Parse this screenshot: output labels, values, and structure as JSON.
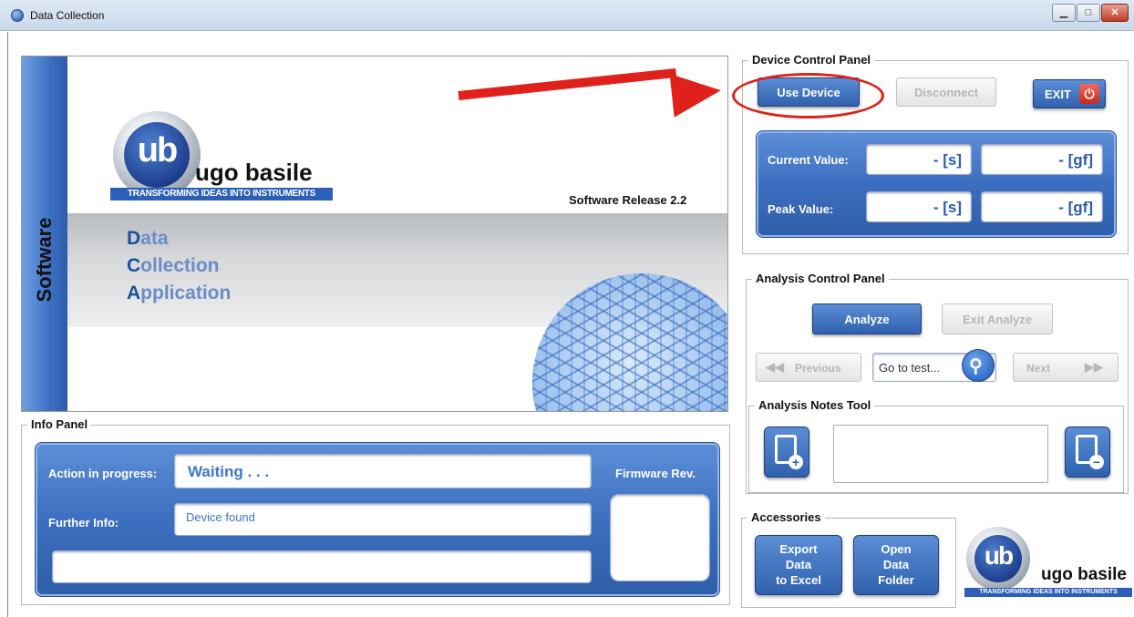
{
  "window": {
    "title": "Data Collection",
    "controls": {
      "minimize": "▁",
      "maximize": "□",
      "close": "✕"
    }
  },
  "banner": {
    "side_label": "Software",
    "logo_mark": "ub",
    "logo_name": "ugo basile",
    "logo_tagline": "TRANSFORMING IDEAS INTO INSTRUMENTS",
    "release": "Software Release 2.2",
    "lines": [
      {
        "first": "D",
        "rest": "ata"
      },
      {
        "first": "C",
        "rest": "ollection"
      },
      {
        "first": "A",
        "rest": "pplication"
      }
    ]
  },
  "device_panel": {
    "title": "Device Control Panel",
    "use_device": "Use Device",
    "disconnect": "Disconnect",
    "exit": "EXIT",
    "current_label": "Current Value:",
    "peak_label": "Peak Value:",
    "current_time": "- [s]",
    "current_force": "- [gf]",
    "peak_time": "- [s]",
    "peak_force": "- [gf]"
  },
  "analysis_panel": {
    "title": "Analysis Control Panel",
    "analyze": "Analyze",
    "exit_analyze": "Exit Analyze",
    "previous": "Previous",
    "next": "Next",
    "goto_placeholder": "Go to test..."
  },
  "notes_tool": {
    "title": "Analysis Notes Tool"
  },
  "accessories": {
    "title": "Accessories",
    "export_l1": "Export",
    "export_l2": "Data",
    "export_l3": "to Excel",
    "open_l1": "Open",
    "open_l2": "Data",
    "open_l3": "Folder",
    "logo_mark": "ub",
    "logo_name": "ugo basile",
    "logo_tagline": "TRANSFORMING IDEAS INTO INSTRUMENTS"
  },
  "info_panel": {
    "title": "Info Panel",
    "action_label": "Action in progress:",
    "action_value": "Waiting . . .",
    "further_label": "Further Info:",
    "further_value": "Device found",
    "firmware_label": "Firmware Rev.",
    "extra_value": "",
    "firmware_value": ""
  }
}
